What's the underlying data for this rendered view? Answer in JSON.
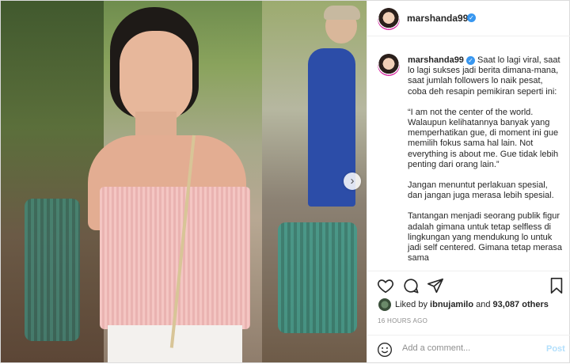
{
  "post": {
    "username": "marshanda99",
    "verified_mark": "✓"
  },
  "caption": {
    "username": "marshanda99",
    "paragraphs": [
      "Saat lo lagi viral, saat lo lagi sukses jadi berita dimana-mana, saat jumlah followers lo naik pesat, coba deh resapin pemikiran seperti ini:",
      "“I am not the center of the world. Walaupun kelihatannya banyak yang memperhatikan gue, di moment ini gue memilih fokus sama hal lain. Not everything is about me. Gue tidak lebih penting dari orang lain.”",
      "Jangan menuntut perlakuan spesial, dan jangan juga merasa lebih spesial.",
      "Tantangan menjadi seorang publik figur adalah gimana untuk tetap selfless di lingkungan yang mendukung lo untuk jadi self centered. Gimana tetap merasa sama"
    ]
  },
  "actions": {
    "like_icon": "heart-icon",
    "comment_icon": "comment-icon",
    "share_icon": "paper-plane-icon",
    "save_icon": "bookmark-icon"
  },
  "likes": {
    "prefix": "Liked by",
    "user": "ibnujamilo",
    "connector": "and",
    "others": "93,087 others"
  },
  "timestamp": "16 HOURS AGO",
  "comment_box": {
    "placeholder": "Add a comment...",
    "post_label": "Post"
  },
  "carousel": {
    "next_glyph": "›"
  },
  "colors": {
    "verified": "#3897f0",
    "post_button_disabled": "#b2dffc",
    "border": "#dbdbdb",
    "muted_text": "#8e8e8e"
  }
}
